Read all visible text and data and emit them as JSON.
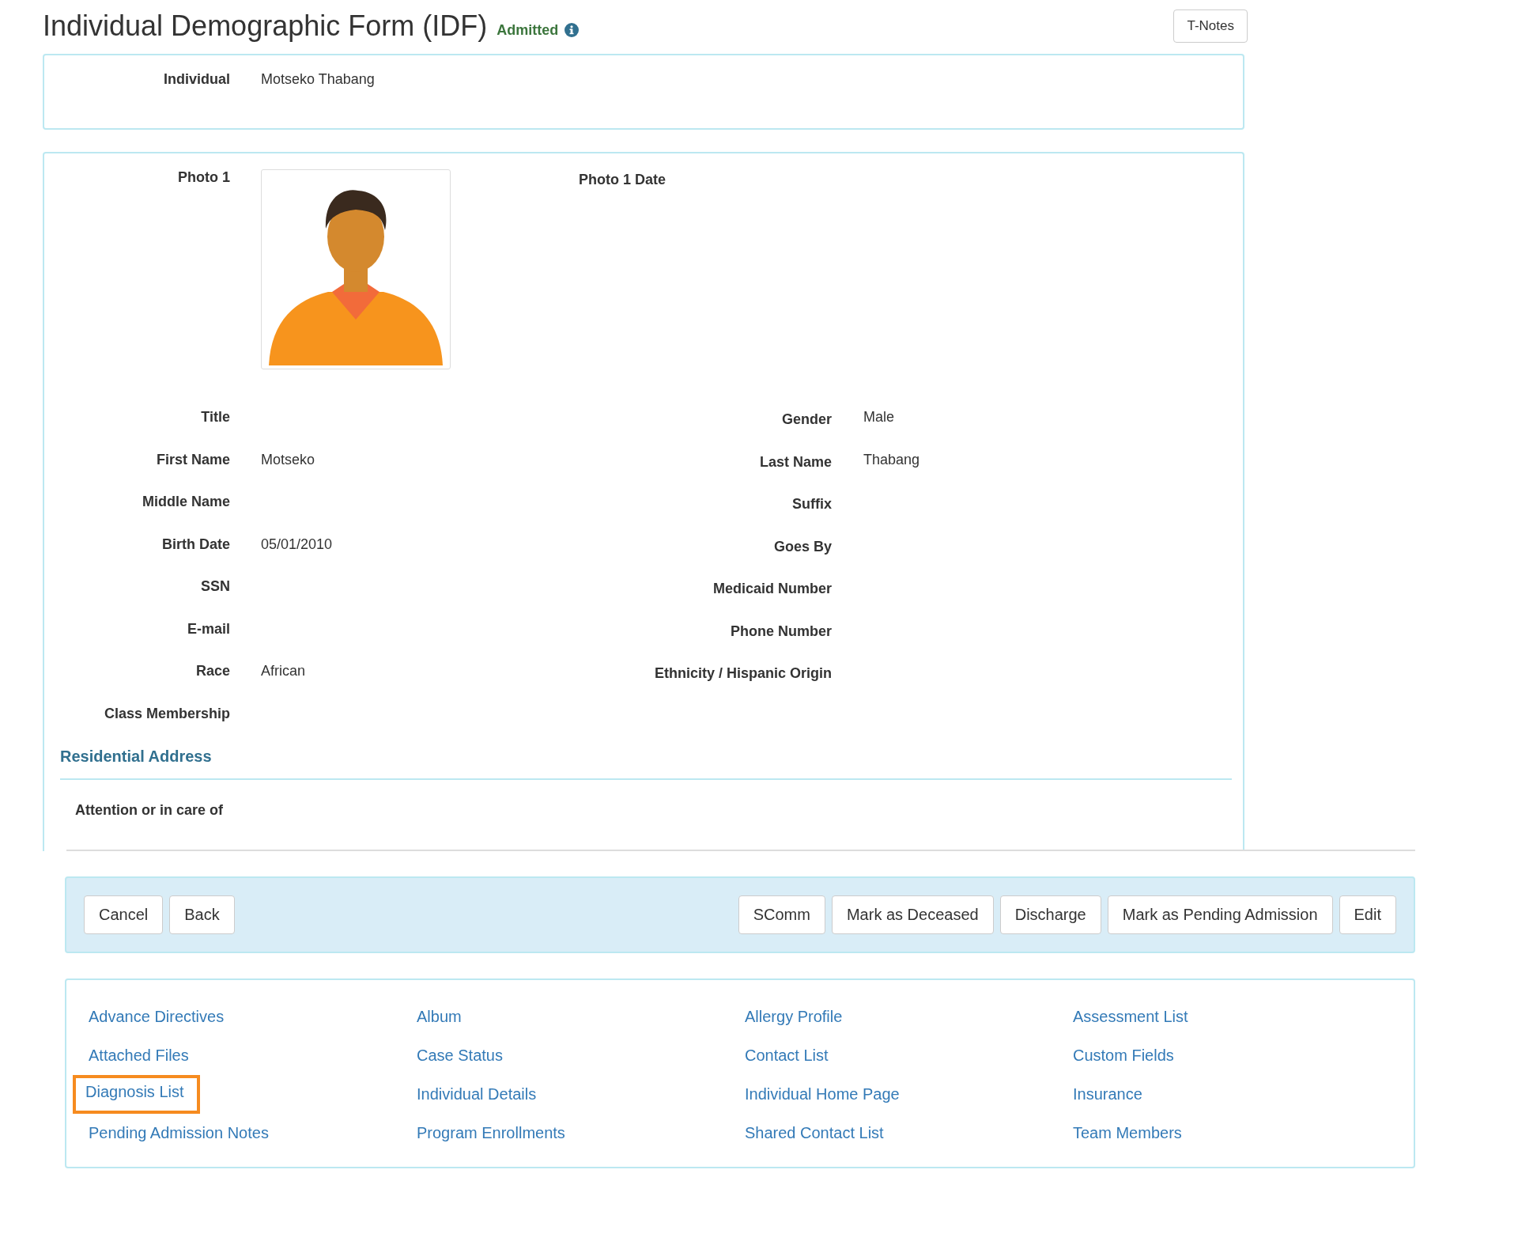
{
  "header": {
    "title": "Individual Demographic Form (IDF)",
    "status": "Admitted",
    "button": "T-Notes"
  },
  "individual": {
    "label": "Individual",
    "value": "Motseko Thabang"
  },
  "photo": {
    "label": "Photo 1",
    "date_label": "Photo 1 Date"
  },
  "rows": [
    {
      "left": {
        "label": "Title"
      },
      "right": {
        "label": "Gender",
        "value": "Male"
      }
    },
    {
      "left": {
        "label": "First Name",
        "value": "Motseko"
      },
      "right": {
        "label": "Last Name",
        "value": "Thabang"
      }
    },
    {
      "left": {
        "label": "Middle Name"
      },
      "right": {
        "label": "Suffix"
      }
    },
    {
      "left": {
        "label": "Birth Date",
        "value": "05/01/2010"
      },
      "right": {
        "label": "Goes By"
      }
    },
    {
      "left": {
        "label": "SSN"
      },
      "right": {
        "label": "Medicaid Number"
      }
    },
    {
      "left": {
        "label": "E-mail"
      },
      "right": {
        "label": "Phone Number"
      }
    },
    {
      "left": {
        "label": "Race",
        "value": "African"
      },
      "right": {
        "label": "Ethnicity / Hispanic Origin"
      }
    },
    {
      "left": {
        "label": "Class Membership"
      }
    }
  ],
  "address": {
    "heading": "Residential Address",
    "field": "Attention or in care of"
  },
  "buttons_left": [
    "Cancel",
    "Back"
  ],
  "buttons_right": [
    "SComm",
    "Mark as Deceased",
    "Discharge",
    "Mark as Pending Admission",
    "Edit"
  ],
  "links": [
    {
      "label": "Advance Directives",
      "highlighted": false
    },
    {
      "label": "Album",
      "highlighted": false
    },
    {
      "label": "Allergy Profile",
      "highlighted": false
    },
    {
      "label": "Assessment List",
      "highlighted": false
    },
    {
      "label": "Attached Files",
      "highlighted": false
    },
    {
      "label": "Case Status",
      "highlighted": false
    },
    {
      "label": "Contact List",
      "highlighted": false
    },
    {
      "label": "Custom Fields",
      "highlighted": false
    },
    {
      "label": "Diagnosis List",
      "highlighted": true
    },
    {
      "label": "Individual Details",
      "highlighted": false
    },
    {
      "label": "Individual Home Page",
      "highlighted": false
    },
    {
      "label": "Insurance",
      "highlighted": false
    },
    {
      "label": "Pending Admission Notes",
      "highlighted": false
    },
    {
      "label": "Program Enrollments",
      "highlighted": false
    },
    {
      "label": "Shared Contact List",
      "highlighted": false
    },
    {
      "label": "Team Members",
      "highlighted": false
    }
  ]
}
